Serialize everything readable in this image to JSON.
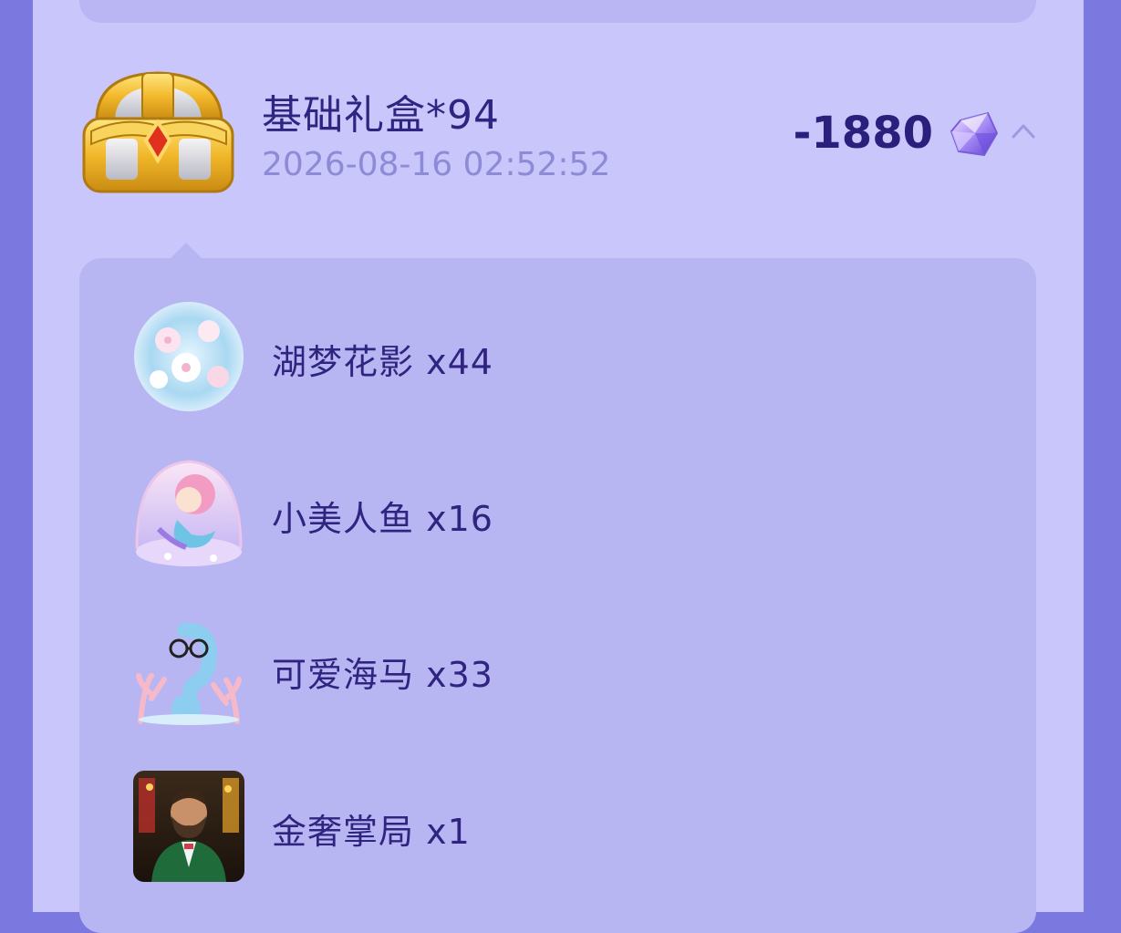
{
  "record": {
    "title": "基础礼盒*94",
    "timestamp": "2026-08-16 02:52:52",
    "amount": "-1880",
    "currency_icon": "crystal-gem-icon",
    "expand_icon": "chevron-up-icon"
  },
  "gifts": [
    {
      "label": "湖梦花影 x44",
      "icon": "flower-bubble-icon"
    },
    {
      "label": "小美人鱼 x16",
      "icon": "mermaid-icon"
    },
    {
      "label": "可爱海马 x33",
      "icon": "seahorse-icon"
    },
    {
      "label": "金奢掌局 x1",
      "icon": "gentleman-portrait-icon"
    }
  ],
  "colors": {
    "background": "#7b78e0",
    "panel": "#c8c6fb",
    "card": "#b8b6f2",
    "title_text": "#2f2480",
    "time_text": "#8d8ad6"
  }
}
